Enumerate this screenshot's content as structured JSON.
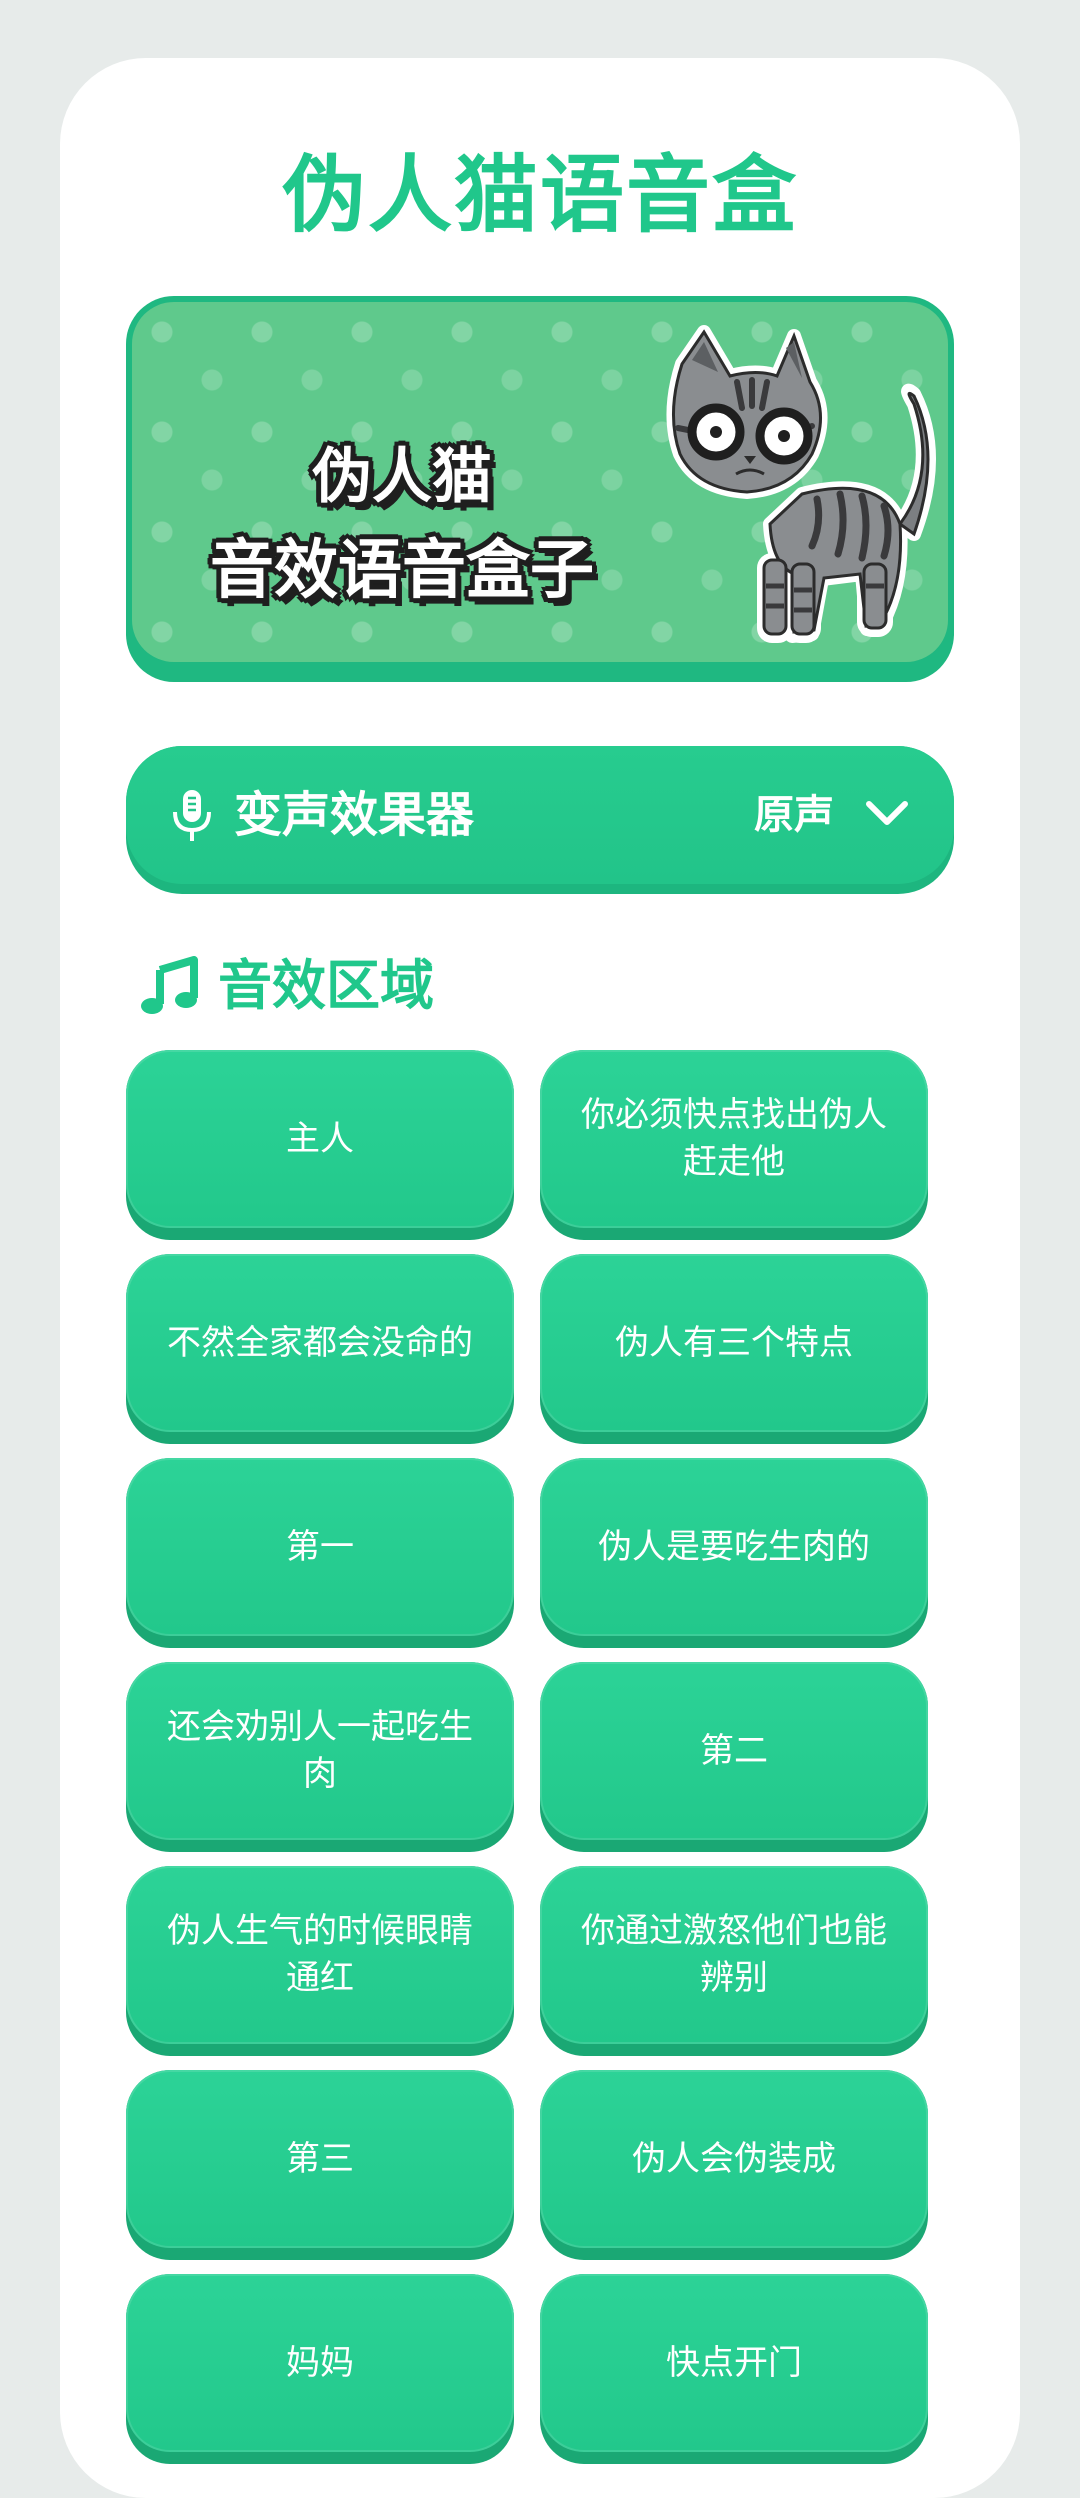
{
  "app": {
    "title": "伪人猫语音盒"
  },
  "banner": {
    "line1": "伪人猫",
    "line2": "音效语音盒子"
  },
  "voice_changer": {
    "label": "变声效果器",
    "value": "原声",
    "icon": "microphone-icon",
    "dropdown_icon": "chevron-down-icon"
  },
  "section": {
    "title": "音效区域",
    "icon": "music-note-icon"
  },
  "sounds": [
    {
      "label": "主人"
    },
    {
      "label": "你必须快点找出伪人赶走他"
    },
    {
      "label": "不然全家都会没命的"
    },
    {
      "label": "伪人有三个特点"
    },
    {
      "label": "第一"
    },
    {
      "label": "伪人是要吃生肉的"
    },
    {
      "label": "还会劝别人一起吃生肉"
    },
    {
      "label": "第二"
    },
    {
      "label": "伪人生气的时候眼睛通红"
    },
    {
      "label": "你通过激怒他们也能辨别"
    },
    {
      "label": "第三"
    },
    {
      "label": "伪人会伪装成"
    },
    {
      "label": "妈妈"
    },
    {
      "label": "快点开门"
    }
  ],
  "colors": {
    "accent": "#20c78b",
    "button": "#22c88b",
    "button_shadow": "#1aa874",
    "page_bg": "#e7ebea",
    "card_bg": "#ffffff"
  }
}
